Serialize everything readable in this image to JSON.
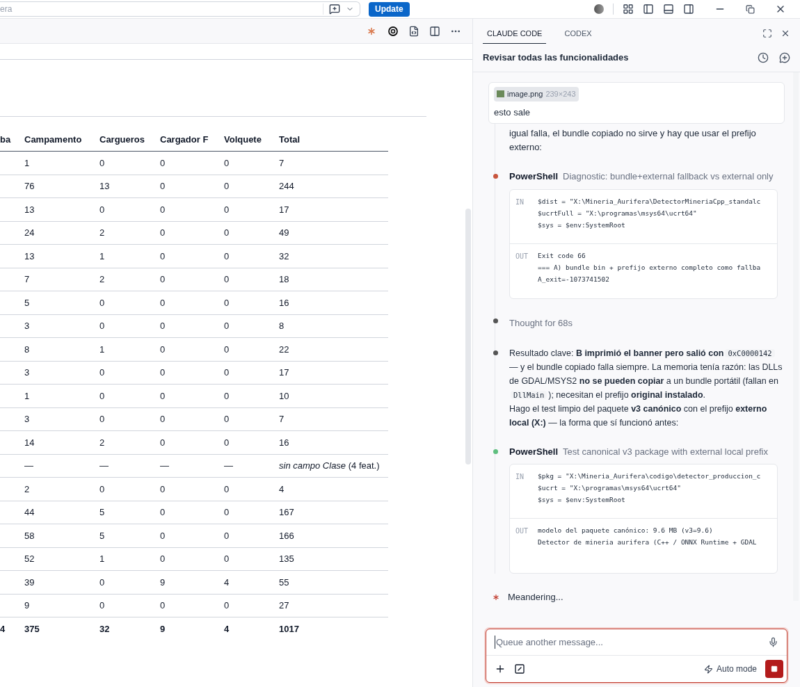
{
  "top_bar": {
    "search": {
      "value": "era"
    },
    "update_button": "Update"
  },
  "table": {
    "columns": [
      "ba",
      "Campamento",
      "Cargueros",
      "Cargador F",
      "Volquete",
      "Total"
    ],
    "rows": [
      {
        "cells": [
          "",
          "1",
          "0",
          "0",
          "0",
          "7"
        ]
      },
      {
        "cells": [
          "",
          "76",
          "13",
          "0",
          "0",
          "244"
        ]
      },
      {
        "cells": [
          "",
          "13",
          "0",
          "0",
          "0",
          "17"
        ]
      },
      {
        "cells": [
          "",
          "24",
          "2",
          "0",
          "0",
          "49"
        ]
      },
      {
        "cells": [
          "",
          "13",
          "1",
          "0",
          "0",
          "32"
        ]
      },
      {
        "cells": [
          "",
          "7",
          "2",
          "0",
          "0",
          "18"
        ]
      },
      {
        "cells": [
          "",
          "5",
          "0",
          "0",
          "0",
          "16"
        ]
      },
      {
        "cells": [
          "",
          "3",
          "0",
          "0",
          "0",
          "8"
        ]
      },
      {
        "cells": [
          "",
          "8",
          "1",
          "0",
          "0",
          "22"
        ]
      },
      {
        "cells": [
          "",
          "3",
          "0",
          "0",
          "0",
          "17"
        ]
      },
      {
        "cells": [
          "",
          "1",
          "0",
          "0",
          "0",
          "10"
        ]
      },
      {
        "cells": [
          "",
          "3",
          "0",
          "0",
          "0",
          "7"
        ]
      },
      {
        "cells": [
          "",
          "14",
          "2",
          "0",
          "0",
          "16"
        ]
      },
      {
        "cells": [
          "",
          "—",
          "—",
          "—",
          "—",
          "*sin campo Clase* (4 feat.)"
        ]
      },
      {
        "cells": [
          "",
          "2",
          "0",
          "0",
          "0",
          "4"
        ]
      },
      {
        "cells": [
          "",
          "44",
          "5",
          "0",
          "0",
          "167"
        ]
      },
      {
        "cells": [
          "",
          "58",
          "5",
          "0",
          "0",
          "166"
        ]
      },
      {
        "cells": [
          "",
          "52",
          "1",
          "0",
          "0",
          "135"
        ]
      },
      {
        "cells": [
          "",
          "39",
          "0",
          "9",
          "4",
          "55"
        ]
      },
      {
        "cells": [
          "",
          "9",
          "0",
          "0",
          "0",
          "27"
        ]
      }
    ],
    "total_row": {
      "cells": [
        "4",
        "375",
        "32",
        "9",
        "4",
        "1017"
      ]
    }
  },
  "panel": {
    "tabs": [
      {
        "label": "CLAUDE CODE",
        "selected": true
      },
      {
        "label": "CODEX",
        "selected": false
      }
    ],
    "title": "Revisar todas las funcionalidades",
    "user_message": {
      "attachment": {
        "name": "image.png",
        "size": "239×243"
      },
      "text": "esto sale"
    },
    "timeline": [
      {
        "kind": "text",
        "text": "igual falla, el bundle copiado no sirve y hay que usar el prefijo externo:"
      },
      {
        "kind": "tool",
        "name": "PowerShell",
        "description": "Diagnostic: bundle+external fallback vs external only",
        "color": "#c8553d",
        "in_label": "IN",
        "in_lines": [
          "$dist = \"X:\\Mineria_Aurifera\\DetectorMineriaCpp_standalc",
          "$ucrtFull = \"X:\\programas\\msys64\\ucrt64\"",
          "$sys = $env:SystemRoot"
        ],
        "out_label": "OUT",
        "out_lines": [
          "Exit code 66",
          "=== A) bundle bin + prefijo externo completo como fallba",
          "A_exit=-1073741502"
        ]
      },
      {
        "kind": "thought",
        "text": "Thought for 68s"
      },
      {
        "kind": "rich",
        "paragraphs": [
          [
            {
              "t": "Resultado clave: **B imprimió el banner pero salió con**"
            },
            {
              "code": "0xC0000142"
            },
            {
              "t": " — y el bundle copiado falla siempre. La memoria tenía razón: las DLLs de GDAL/MSYS2 **no se pueden copiar** a un bundle portátil (fallan en "
            },
            {
              "code": "DllMain"
            },
            {
              "t": "); necesitan el prefijo **original instalado**."
            }
          ],
          [
            {
              "t": "Hago el test limpio del paquete **v3 canónico** con el prefijo **externo local (X:)** — la forma que sí funcionó antes:"
            }
          ]
        ]
      },
      {
        "kind": "tool",
        "name": "PowerShell",
        "description": "Test canonical v3 package with external local prefix",
        "color": "#5fbf7f",
        "in_label": "IN",
        "in_lines": [
          "$pkg = \"X:\\Mineria_Aurifera\\codigo\\detector_produccion_c",
          "$ucrt = \"X:\\programas\\msys64\\ucrt64\"",
          "$sys = $env:SystemRoot"
        ],
        "out_label": "OUT",
        "out_lines": [
          "modelo del paquete canónico: 9.6 MB (v3=9.6)",
          "Detector de mineria aurifera (C++ / ONNX Runtime + GDAL"
        ]
      }
    ],
    "status": "Meandering...",
    "composer": {
      "placeholder": "Queue another message...",
      "mode": "Auto mode"
    }
  }
}
